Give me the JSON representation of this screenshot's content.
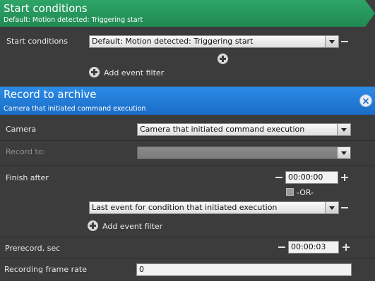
{
  "start_section": {
    "title": "Start conditions",
    "subtitle": "Default: Motion detected: Triggering start",
    "row_label": "Start conditions",
    "selected_value": "Default: Motion detected: Triggering start",
    "add_filter_label": "Add event filter"
  },
  "record_section": {
    "title": "Record to archive",
    "subtitle": "Camera that initiated command execution",
    "camera_label": "Camera",
    "camera_value": "Camera that initiated command execution",
    "record_to_label": "Record to:",
    "record_to_value": "",
    "finish_after_label": "Finish after",
    "finish_after_time": "00:00:00",
    "or_label": "-OR-",
    "finish_condition_value": "Last event for condition that initiated execution",
    "add_filter_label": "Add event filter",
    "prerecord_label": "Prerecord, sec",
    "prerecord_time": "00:00:03",
    "frame_rate_label": "Recording frame rate",
    "frame_rate_value": "0"
  },
  "colors": {
    "start_banner": "#2ea468",
    "record_banner": "#2c8be6",
    "panel_bg": "#3c3c3c"
  },
  "icons": [
    "plus-icon",
    "minus-icon",
    "add-circle-icon",
    "close-icon",
    "dropdown-arrow-icon"
  ]
}
